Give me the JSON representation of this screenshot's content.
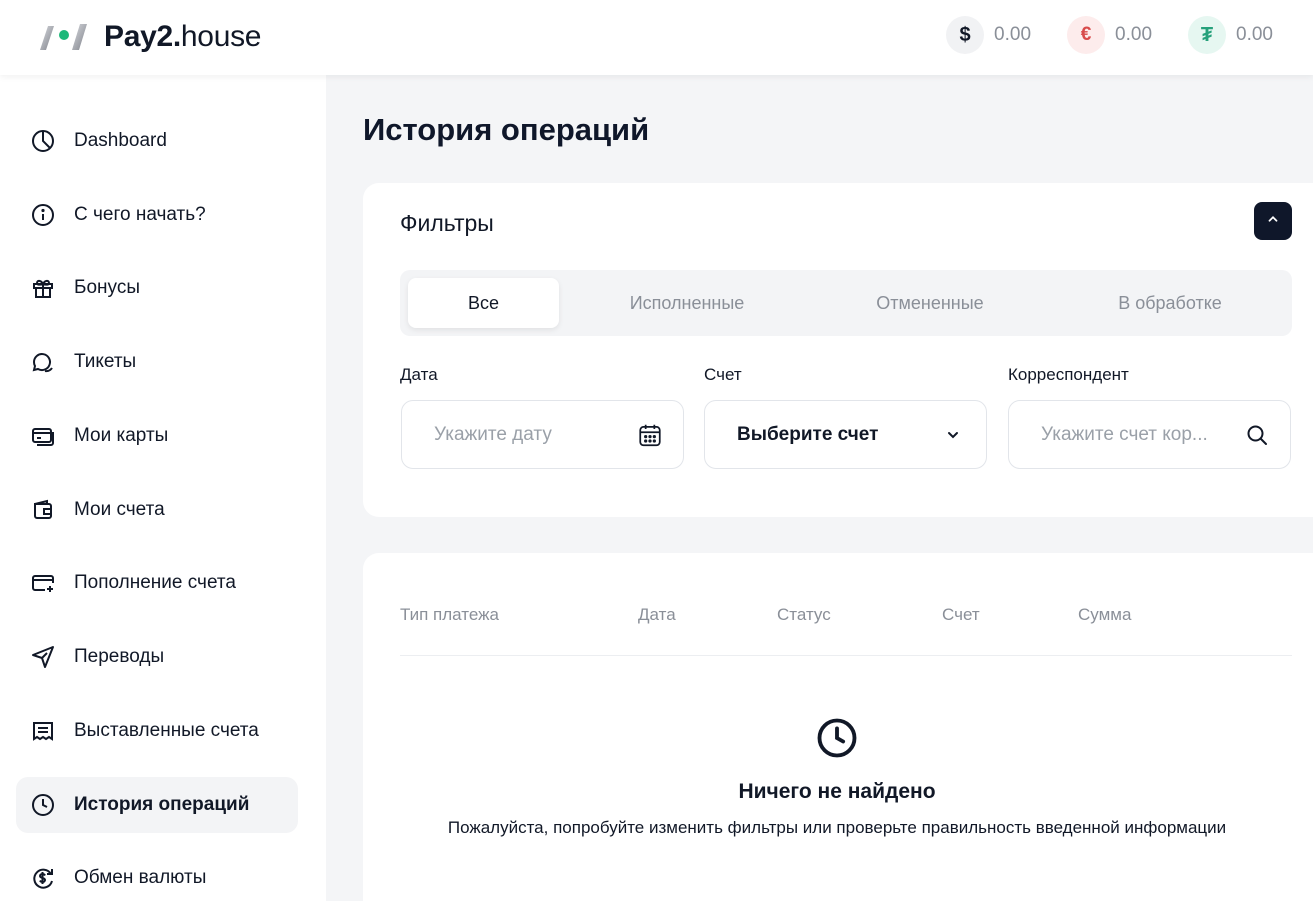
{
  "brand": {
    "name_bold": "Pay2",
    "name_dot": ".",
    "name_light": "house"
  },
  "balances": [
    {
      "currency_symbol": "$",
      "value": "0.00",
      "icon": "dollar-icon"
    },
    {
      "currency_symbol": "€",
      "value": "0.00",
      "icon": "euro-icon"
    },
    {
      "currency_symbol": "₮",
      "value": "0.00",
      "icon": "tether-icon"
    }
  ],
  "sidebar": {
    "items": [
      {
        "label": "Dashboard",
        "icon": "pie-chart-icon"
      },
      {
        "label": "С чего начать?",
        "icon": "info-icon"
      },
      {
        "label": "Бонусы",
        "icon": "gift-icon"
      },
      {
        "label": "Тикеты",
        "icon": "chat-icon"
      },
      {
        "label": "Мои карты",
        "icon": "cards-icon"
      },
      {
        "label": "Мои счета",
        "icon": "wallet-icon"
      },
      {
        "label": "Пополнение счета",
        "icon": "card-plus-icon"
      },
      {
        "label": "Переводы",
        "icon": "send-icon"
      },
      {
        "label": "Выставленные счета",
        "icon": "receipt-icon"
      },
      {
        "label": "История операций",
        "icon": "clock-icon",
        "active": true
      },
      {
        "label": "Обмен валюты",
        "icon": "exchange-icon"
      }
    ]
  },
  "page": {
    "title": "История операций"
  },
  "filters": {
    "title": "Фильтры",
    "tabs": [
      {
        "label": "Все",
        "active": true
      },
      {
        "label": "Исполненные"
      },
      {
        "label": "Отмененные"
      },
      {
        "label": "В обработке"
      }
    ],
    "date": {
      "label": "Дата",
      "placeholder": "Укажите дату"
    },
    "account": {
      "label": "Счет",
      "value": "Выберите счет"
    },
    "correspondent": {
      "label": "Корреспондент",
      "placeholder": "Укажите счет кор..."
    }
  },
  "table": {
    "columns": [
      "Тип платежа",
      "Дата",
      "Статус",
      "Счет",
      "Сумма"
    ],
    "empty_title": "Ничего не найдено",
    "empty_text": "Пожалуйста, попробуйте изменить фильтры или проверьте правильность введенной информации"
  },
  "colors": {
    "accent": "#0f172a",
    "usdt": "#26a17b",
    "eur": "#d84b4b",
    "brand_dot": "#1db87a"
  }
}
